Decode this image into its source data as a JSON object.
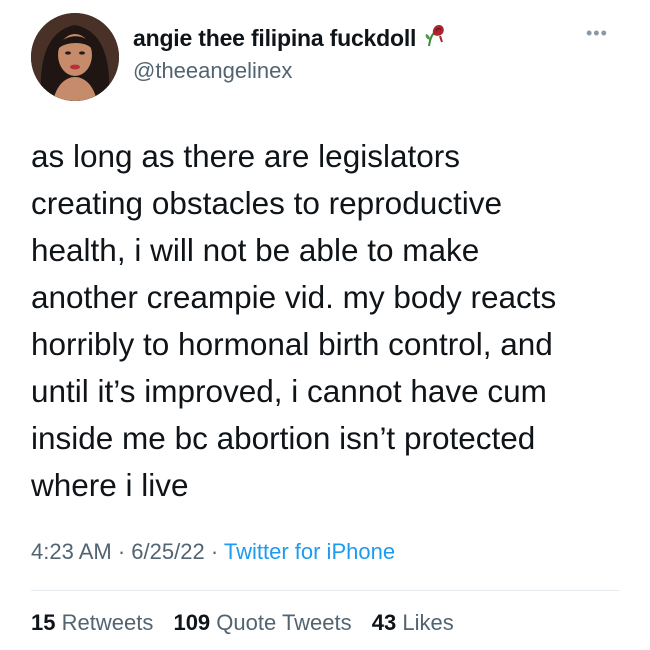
{
  "user": {
    "display_name": "angie thee filipina fuckdoll",
    "handle": "@theeangelinex",
    "name_emoji_icon": "wilted-rose-icon"
  },
  "tweet": {
    "lines": [
      "as long as there are legislators",
      "creating obstacles to reproductive",
      "health, i will not be able to make",
      "another creampie vid. my body reacts",
      "horribly to hormonal birth control, and",
      "until it’s improved, i cannot have cum",
      "inside me bc abortion isn’t protected",
      "where i live"
    ],
    "time": "4:23 AM",
    "date": "6/25/22",
    "separator": "·",
    "source": "Twitter for iPhone"
  },
  "stats": {
    "retweets_count": "15",
    "retweets_label": "Retweets",
    "quote_count": "109",
    "quote_label": "Quote Tweets",
    "likes_count": "43",
    "likes_label": "Likes"
  },
  "colors": {
    "text": "#0f1419",
    "muted": "#536471",
    "link": "#1d9bf0"
  }
}
